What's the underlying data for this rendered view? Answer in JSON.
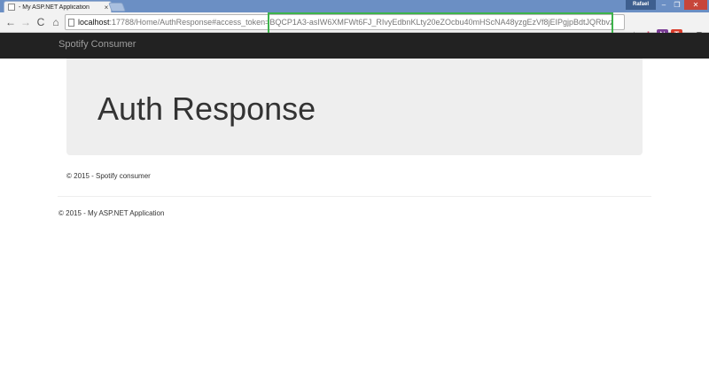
{
  "browser": {
    "tab_title": "- My ASP.NET Application",
    "tab_close": "×",
    "profile_name": "Rafael",
    "window_controls": {
      "minimize": "–",
      "maximize": "❐",
      "close": "✕"
    },
    "nav": {
      "back": "←",
      "forward": "→",
      "reload": "C",
      "home": "⌂"
    },
    "url_host": "localhost",
    "url_rest": ":17788/Home/AuthResponse#access_token=BQCP1A3-asIW6XMFWt6FJ_RIvyEdbnKLty20eZOcbu40mHScNA48yzgEzVf8jEIPgjpBdtJQRbvz",
    "star": "☆",
    "menu": "≡",
    "highlight_color": "#3db34b"
  },
  "page": {
    "brand": "Spotify Consumer",
    "heading": "Auth Response",
    "inner_footer": "© 2015 - Spotify consumer",
    "outer_footer": "© 2015 - My ASP.NET Application",
    "colors": {
      "navbar": "#222222",
      "jumbotron": "#eeeeee"
    }
  }
}
